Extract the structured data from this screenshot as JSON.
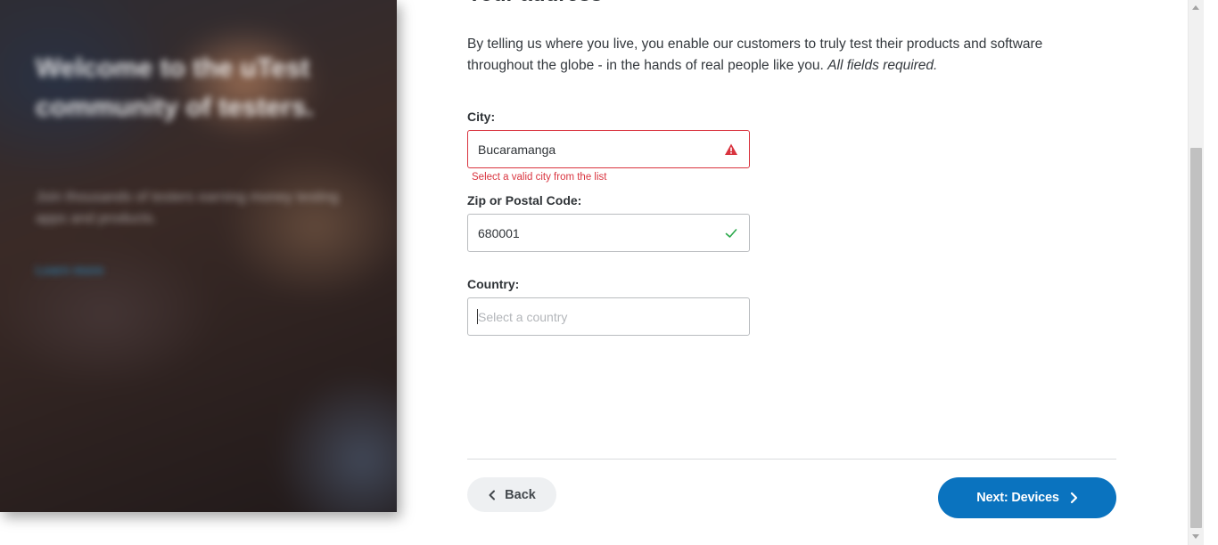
{
  "hero": {
    "title": "Welcome to the uTest community of testers.",
    "subtitle": "Join thousands of testers earning money testing apps and products.",
    "link": "Learn more"
  },
  "form": {
    "heading": "Your address",
    "intro": "By telling us where you live, you enable our customers to truly test their products and software throughout the globe - in the hands of real people like you.",
    "intro_required": "All fields required.",
    "city": {
      "label": "City:",
      "value": "Bucaramanga",
      "error": "Select a valid city from the list",
      "status_icon": "warning-icon"
    },
    "zip": {
      "label": "Zip or Postal Code:",
      "value": "680001",
      "status_icon": "check-icon"
    },
    "country": {
      "label": "Country:",
      "placeholder": "Select a country",
      "value": ""
    }
  },
  "nav": {
    "back_label": "Back",
    "next_label": "Next: Devices"
  },
  "colors": {
    "error": "#d9343f",
    "success": "#2aa84a",
    "primary": "#0a73bf"
  }
}
